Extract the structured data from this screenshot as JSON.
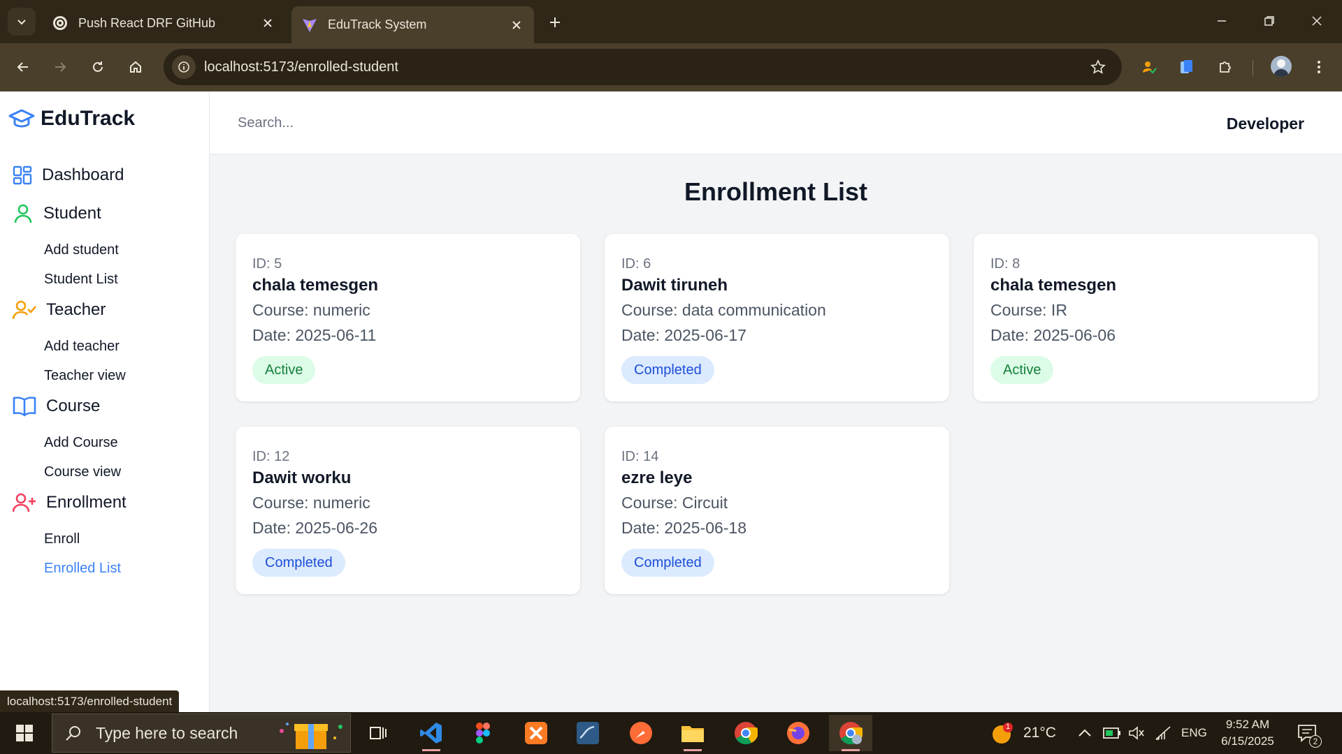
{
  "browser": {
    "tabs": [
      {
        "title": "Push React DRF GitHub"
      },
      {
        "title": "EduTrack System"
      }
    ],
    "url": "localhost:5173/enrolled-student",
    "status_url": "localhost:5173/enrolled-student"
  },
  "app": {
    "brand": "EduTrack",
    "search_placeholder": "Search...",
    "user": "Developer",
    "accent": "#3b82f6",
    "nav": {
      "dashboard": "Dashboard",
      "student": {
        "label": "Student",
        "items": [
          "Add student",
          "Student List"
        ]
      },
      "teacher": {
        "label": "Teacher",
        "items": [
          "Add teacher",
          "Teacher view"
        ]
      },
      "course": {
        "label": "Course",
        "items": [
          "Add Course",
          "Course view"
        ]
      },
      "enrollment": {
        "label": "Enrollment",
        "items": [
          "Enroll",
          "Enrolled List"
        ]
      }
    },
    "page_title": "Enrollment List",
    "enrollments": [
      {
        "id": "ID: 5",
        "name": "chala temesgen",
        "course": "Course: numeric",
        "date": "Date: 2025-06-11",
        "status": "Active"
      },
      {
        "id": "ID: 6",
        "name": "Dawit tiruneh",
        "course": "Course: data communication",
        "date": "Date: 2025-06-17",
        "status": "Completed"
      },
      {
        "id": "ID: 8",
        "name": "chala temesgen",
        "course": "Course: IR",
        "date": "Date: 2025-06-06",
        "status": "Active"
      },
      {
        "id": "ID: 12",
        "name": "Dawit worku",
        "course": "Course: numeric",
        "date": "Date: 2025-06-26",
        "status": "Completed"
      },
      {
        "id": "ID: 14",
        "name": "ezre leye",
        "course": "Course: Circuit",
        "date": "Date: 2025-06-18",
        "status": "Completed"
      }
    ]
  },
  "taskbar": {
    "search_placeholder": "Type here to search",
    "weather": "21°C",
    "weather_badge": "1",
    "language": "ENG",
    "time": "9:52 AM",
    "date": "6/15/2025",
    "notifications": "2"
  }
}
